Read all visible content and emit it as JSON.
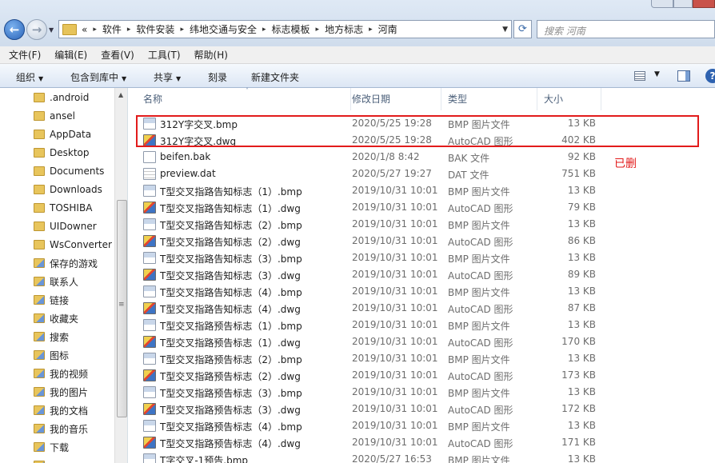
{
  "window": {
    "background_text": "…"
  },
  "address": {
    "overflow": "«",
    "crumbs": [
      "软件",
      "软件安装",
      "纬地交通与安全",
      "标志模板",
      "地方标志",
      "河南"
    ]
  },
  "search": {
    "placeholder": "搜索 河南"
  },
  "menu": [
    "文件(F)",
    "编辑(E)",
    "查看(V)",
    "工具(T)",
    "帮助(H)"
  ],
  "toolbar": {
    "organize": "组织",
    "include_in_library": "包含到库中",
    "share": "共享",
    "burn": "刻录",
    "new_folder": "新建文件夹"
  },
  "nav": [
    ".android",
    "ansel",
    "AppData",
    "Desktop",
    "Documents",
    "Downloads",
    "TOSHIBA",
    "UIDowner",
    "WsConverter",
    "保存的游戏",
    "联系人",
    "链接",
    "收藏夹",
    "搜索",
    "图标",
    "我的视频",
    "我的图片",
    "我的文档",
    "我的音乐",
    "下载",
    "…"
  ],
  "columns": {
    "name": "名称",
    "date": "修改日期",
    "type": "类型",
    "size": "大小"
  },
  "files": [
    {
      "icon": "bmp",
      "name": "312Y字交叉.bmp",
      "date": "2020/5/25 19:28",
      "type": "BMP 图片文件",
      "size": "13 KB"
    },
    {
      "icon": "dwg",
      "name": "312Y字交叉.dwg",
      "date": "2020/5/25 19:28",
      "type": "AutoCAD 图形",
      "size": "402 KB"
    },
    {
      "icon": "bak",
      "name": "beifen.bak",
      "date": "2020/1/8 8:42",
      "type": "BAK 文件",
      "size": "92 KB"
    },
    {
      "icon": "dat",
      "name": "preview.dat",
      "date": "2020/5/27 19:27",
      "type": "DAT 文件",
      "size": "751 KB"
    },
    {
      "icon": "bmp",
      "name": "T型交叉指路告知标志（1）.bmp",
      "date": "2019/10/31 10:01",
      "type": "BMP 图片文件",
      "size": "13 KB"
    },
    {
      "icon": "dwg",
      "name": "T型交叉指路告知标志（1）.dwg",
      "date": "2019/10/31 10:01",
      "type": "AutoCAD 图形",
      "size": "79 KB"
    },
    {
      "icon": "bmp",
      "name": "T型交叉指路告知标志（2）.bmp",
      "date": "2019/10/31 10:01",
      "type": "BMP 图片文件",
      "size": "13 KB"
    },
    {
      "icon": "dwg",
      "name": "T型交叉指路告知标志（2）.dwg",
      "date": "2019/10/31 10:01",
      "type": "AutoCAD 图形",
      "size": "86 KB"
    },
    {
      "icon": "bmp",
      "name": "T型交叉指路告知标志（3）.bmp",
      "date": "2019/10/31 10:01",
      "type": "BMP 图片文件",
      "size": "13 KB"
    },
    {
      "icon": "dwg",
      "name": "T型交叉指路告知标志（3）.dwg",
      "date": "2019/10/31 10:01",
      "type": "AutoCAD 图形",
      "size": "89 KB"
    },
    {
      "icon": "bmp",
      "name": "T型交叉指路告知标志（4）.bmp",
      "date": "2019/10/31 10:01",
      "type": "BMP 图片文件",
      "size": "13 KB"
    },
    {
      "icon": "dwg",
      "name": "T型交叉指路告知标志（4）.dwg",
      "date": "2019/10/31 10:01",
      "type": "AutoCAD 图形",
      "size": "87 KB"
    },
    {
      "icon": "bmp",
      "name": "T型交叉指路预告标志（1）.bmp",
      "date": "2019/10/31 10:01",
      "type": "BMP 图片文件",
      "size": "13 KB"
    },
    {
      "icon": "dwg",
      "name": "T型交叉指路预告标志（1）.dwg",
      "date": "2019/10/31 10:01",
      "type": "AutoCAD 图形",
      "size": "170 KB"
    },
    {
      "icon": "bmp",
      "name": "T型交叉指路预告标志（2）.bmp",
      "date": "2019/10/31 10:01",
      "type": "BMP 图片文件",
      "size": "13 KB"
    },
    {
      "icon": "dwg",
      "name": "T型交叉指路预告标志（2）.dwg",
      "date": "2019/10/31 10:01",
      "type": "AutoCAD 图形",
      "size": "173 KB"
    },
    {
      "icon": "bmp",
      "name": "T型交叉指路预告标志（3）.bmp",
      "date": "2019/10/31 10:01",
      "type": "BMP 图片文件",
      "size": "13 KB"
    },
    {
      "icon": "dwg",
      "name": "T型交叉指路预告标志（3）.dwg",
      "date": "2019/10/31 10:01",
      "type": "AutoCAD 图形",
      "size": "172 KB"
    },
    {
      "icon": "bmp",
      "name": "T型交叉指路预告标志（4）.bmp",
      "date": "2019/10/31 10:01",
      "type": "BMP 图片文件",
      "size": "13 KB"
    },
    {
      "icon": "dwg",
      "name": "T型交叉指路预告标志（4）.dwg",
      "date": "2019/10/31 10:01",
      "type": "AutoCAD 图形",
      "size": "171 KB"
    },
    {
      "icon": "bmp",
      "name": "T字交叉-1预告.bmp",
      "date": "2020/5/27 16:53",
      "type": "BMP 图片文件",
      "size": "13 KB"
    }
  ],
  "annotation": {
    "label": "已删",
    "color": "#e21b1b"
  }
}
